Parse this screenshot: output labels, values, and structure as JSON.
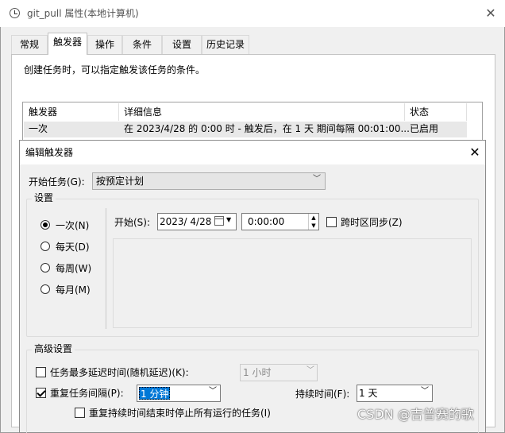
{
  "outer_window": {
    "title": "git_pull 属性(本地计算机)",
    "tabs": [
      {
        "label": "常规"
      },
      {
        "label": "触发器"
      },
      {
        "label": "操作"
      },
      {
        "label": "条件"
      },
      {
        "label": "设置"
      },
      {
        "label": "历史记录"
      }
    ],
    "active_tab": "触发器",
    "description": "创建任务时，可以指定触发该任务的条件。",
    "trigger_table": {
      "headers": [
        "触发器",
        "详细信息",
        "状态"
      ],
      "rows": [
        {
          "trigger": "一次",
          "details": "在 2023/4/28 的 0:00 时 - 触发后，在 1 天 期间每隔 00:01:00...",
          "status": "已启用"
        }
      ]
    }
  },
  "edit_dialog": {
    "title": "编辑触发器",
    "begin_task_label": "开始任务(G):",
    "begin_task_value": "按预定计划",
    "settings_label": "设置",
    "schedule_options": [
      {
        "label": "一次(N)",
        "selected": true
      },
      {
        "label": "每天(D)",
        "selected": false
      },
      {
        "label": "每周(W)",
        "selected": false
      },
      {
        "label": "每月(M)",
        "selected": false
      }
    ],
    "start_label": "开始(S):",
    "start_date": "2023/  4/28",
    "start_time": "0:00:00",
    "sync_timezone_label": "跨时区同步(Z)",
    "sync_timezone_checked": false,
    "advanced_label": "高级设置",
    "delay": {
      "label": "任务最多延迟时间(随机延迟)(K):",
      "checked": false,
      "value": "1 小时"
    },
    "repeat": {
      "label": "重复任务间隔(P):",
      "checked": true,
      "value": "1 分钟"
    },
    "duration": {
      "label": "持续时间(F):",
      "value": "1 天"
    },
    "stop_at_end": {
      "label": "重复持续时间结束时停止所有运行的任务(I)",
      "checked": false
    }
  },
  "watermark": "CSDN @吉普赛的歌"
}
